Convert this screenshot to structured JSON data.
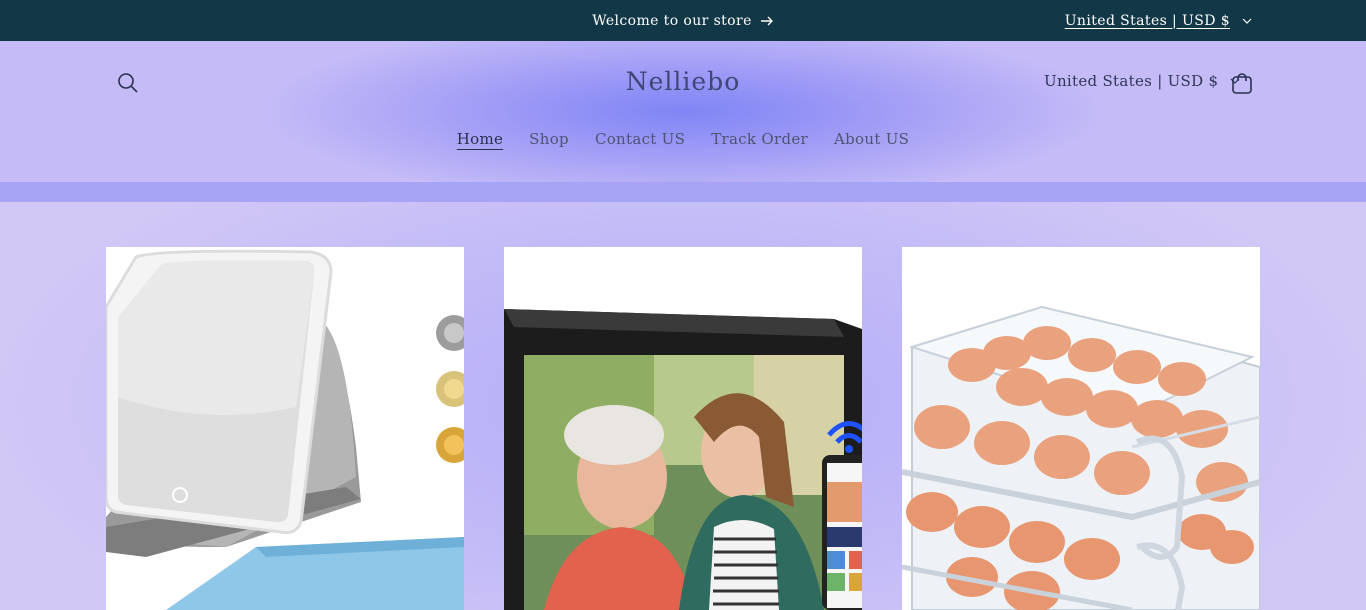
{
  "announcement": {
    "message": "Welcome to our store",
    "arrow_icon": "arrow-right-icon",
    "locale": "United States | USD $"
  },
  "header": {
    "logo": "Nelliebo",
    "locale": "United States | USD $",
    "search_icon": "search-icon",
    "cart_icon": "cart-icon"
  },
  "nav": {
    "items": [
      {
        "label": "Home",
        "active": true
      },
      {
        "label": "Shop",
        "active": false
      },
      {
        "label": "Contact US",
        "active": false
      },
      {
        "label": "Track Order",
        "active": false
      },
      {
        "label": "About US",
        "active": false
      }
    ]
  },
  "products": [
    {
      "image": "lighted-vanity-mirror"
    },
    {
      "image": "digital-photo-frame"
    },
    {
      "image": "stackable-egg-storage-drawers"
    }
  ],
  "colors": {
    "announcement_bg": "#123848",
    "header_glow": "#7f85f5",
    "page_bg": "#c9bff6"
  }
}
